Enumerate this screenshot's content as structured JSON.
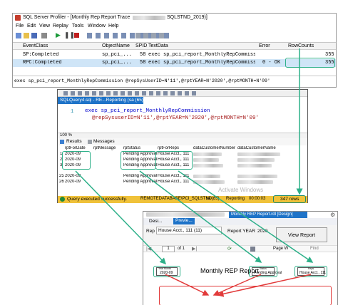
{
  "profiler": {
    "title": "SQL Server Profiler - [Monthly Rep Report Trace",
    "title_suffix": "SQLSTND_2019)]",
    "menu": [
      "File",
      "Edit",
      "View",
      "Replay",
      "Tools",
      "Window",
      "Help"
    ],
    "columns": [
      "EventClass",
      "ObjectName",
      "SPID",
      "TextData",
      "Error",
      "RowCounts"
    ],
    "rows": [
      {
        "event": "SP:Completed",
        "object": "sp_pci_...",
        "spid": "58",
        "text": "exec sp_pci_report_MonthlyRepCommiss...",
        "error": "",
        "rowcounts": "355"
      },
      {
        "event": "RPC:Completed",
        "object": "sp_pci_...",
        "spid": "58",
        "text": "exec sp_pci_report_MonthlyRepCommiss...",
        "error": "0 - OK",
        "rowcounts": "355"
      }
    ],
    "statement": "exec sp_pci_report_MonthlyRepCommission @repSysUserID=N'11',@rptYEAR=N'2020',@rptMONTH=N'09'"
  },
  "ssms": {
    "tab_label": "SQLQuery4.sql - RE...Reporting (sa (65))*",
    "code_line1": "exec sp_pci_report_MonthlyRepCommission",
    "code_line2": "@repSysuserID=N'11',@rptYEAR=N'2020',@rptMONTH=N'09'",
    "line_number": "1",
    "zoom": "100 %",
    "tab_results": "Results",
    "tab_messages": "Messages",
    "columns": [
      "rptForDate",
      "rptMessage",
      "rptStatus",
      "rptForReps",
      "dataCustomerNumber",
      "dataCustomerName"
    ],
    "rows": [
      {
        "num": "1",
        "date": "2020-09",
        "status": "Pending Approval",
        "reps": "House Acct., 111"
      },
      {
        "num": "2",
        "date": "2020-09",
        "status": "Pending Approval",
        "reps": "House Acct., 111"
      },
      {
        "num": "3",
        "date": "2020-09",
        "status": "Pending Approval",
        "reps": "House Acct., 111"
      },
      {
        "num": "25",
        "date": "2020-09",
        "status": "Pending Approval",
        "reps": "House Acct., 111"
      },
      {
        "num": "26",
        "date": "2020-09",
        "status": "Pending Approval",
        "reps": "House Acct., 111"
      }
    ],
    "status_message": "Query executed successfully.",
    "status_server": "REMOTEDATABASE\\PCI_SQLSTND...",
    "status_user": "sa (65)",
    "status_db": "Reporting",
    "status_time": "00:00:03",
    "status_rows": "347 rows",
    "watermark": "Activate Windows"
  },
  "report": {
    "doc_tab": "Monthly REP Report.rdl [Design]",
    "tab_design": "Desi...",
    "tab_preview": "Previe...",
    "rep_label": "Rep",
    "rep_value": "House Acct., 111 (11)",
    "year_label": "Report YEAR",
    "year_value": "2020",
    "view_report": "View Report",
    "page_current": "1",
    "page_of": "of 1",
    "page_width": "Page W",
    "find": "Find",
    "header_title": "Monthly REP Report",
    "month_label": "Year Month",
    "month_value": "2020-09",
    "status_label": "Status",
    "status_value": "Pending Approval",
    "rep_caption": "Reps",
    "rep_box_value": "House Acct., 111"
  },
  "colors": {
    "annotation_green": "#2db089",
    "annotation_red": "#e23b3b",
    "highlight_row": "#cfe5f7",
    "ssms_tab": "#1e73c8",
    "ssms_status": "#f0c23a"
  }
}
